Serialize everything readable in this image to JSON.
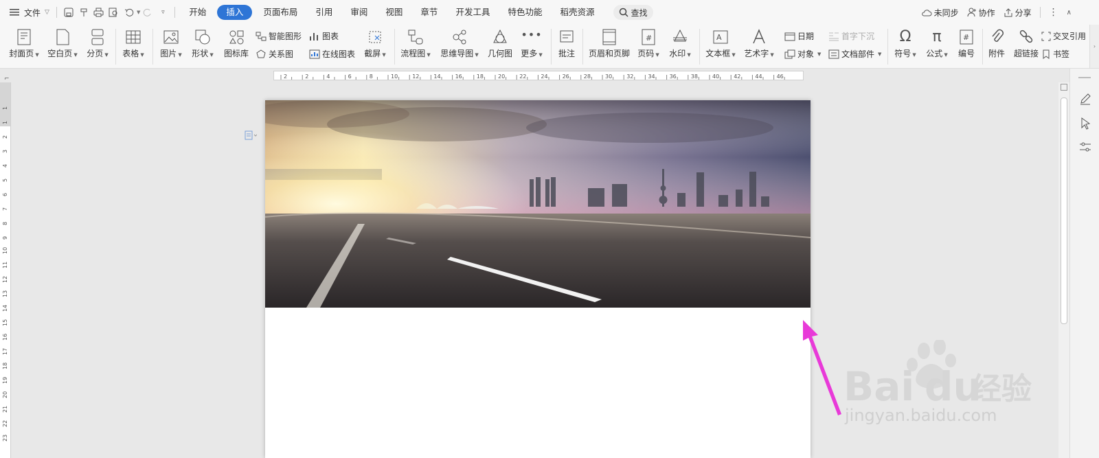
{
  "menu": {
    "file_label": "文件",
    "tabs": [
      "开始",
      "插入",
      "页面布局",
      "引用",
      "审阅",
      "视图",
      "章节",
      "开发工具",
      "特色功能",
      "稻壳资源"
    ],
    "active_tab": "插入",
    "search_label": "查找"
  },
  "top_right": {
    "sync": "未同步",
    "collab": "协作",
    "share": "分享"
  },
  "ribbon": {
    "cover": "封面页",
    "blank": "空白页",
    "break": "分页",
    "table": "表格",
    "picture": "图片",
    "shape": "形状",
    "icon_lib": "图标库",
    "smart_art": "智能图形",
    "chart": "图表",
    "relation": "关系图",
    "online_chart": "在线图表",
    "screenshot": "截屏",
    "flowchart": "流程图",
    "mindmap": "思维导图",
    "geometry": "几何图",
    "more": "更多",
    "comment": "批注",
    "header_footer": "页眉和页脚",
    "page_num": "页码",
    "watermark": "水印",
    "textbox": "文本框",
    "wordart": "艺术字",
    "date": "日期",
    "object": "对象",
    "drop_cap": "首字下沉",
    "doc_parts": "文档部件",
    "symbol": "符号",
    "formula": "公式",
    "numbering": "编号",
    "attachment": "附件",
    "hyperlink": "超链接",
    "crossref": "交叉引用",
    "bookmark": "书签"
  },
  "ruler": {
    "h_ticks": [
      "2",
      "2",
      "4",
      "6",
      "8",
      "10",
      "12",
      "14",
      "16",
      "18",
      "20",
      "22",
      "24",
      "26",
      "28",
      "30",
      "32",
      "34",
      "36",
      "38",
      "40",
      "42",
      "44",
      "46"
    ],
    "v_ticks": [
      "1",
      "1",
      "2",
      "3",
      "4",
      "5",
      "6",
      "7",
      "8",
      "9",
      "10",
      "11",
      "12",
      "13",
      "14",
      "15",
      "16",
      "17",
      "18",
      "19",
      "20",
      "21",
      "22",
      "23"
    ]
  },
  "watermark": {
    "brand": "Bai",
    "brand2": "du",
    "cn": "经验",
    "url": "jingyan.baidu.com"
  },
  "colors": {
    "accent": "#2e75d6",
    "arrow": "#e83ad8"
  }
}
